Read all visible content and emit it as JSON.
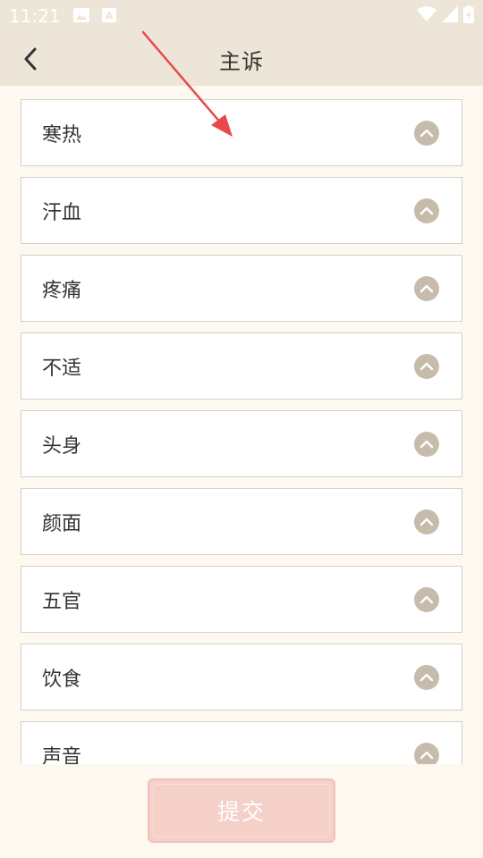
{
  "status_bar": {
    "time": "11:21",
    "left_icons": [
      "image-icon",
      "font-a-icon"
    ],
    "right_icons": [
      "wifi-icon",
      "cell-signal-icon",
      "battery-charging-icon"
    ]
  },
  "header": {
    "title": "主诉",
    "back_icon": "chevron-left-icon"
  },
  "categories": [
    {
      "label": "寒热"
    },
    {
      "label": "汗血"
    },
    {
      "label": "疼痛"
    },
    {
      "label": "不适"
    },
    {
      "label": "头身"
    },
    {
      "label": "颜面"
    },
    {
      "label": "五官"
    },
    {
      "label": "饮食"
    },
    {
      "label": "声音"
    }
  ],
  "toggle_icon": "chevron-up-circle-icon",
  "footer": {
    "submit_label": "提交"
  },
  "colors": {
    "header_bg": "#ece5d8",
    "page_bg": "#fdf9f1",
    "toggle": "#c7bcab",
    "submit_bg": "#f4d0c8",
    "annotation_arrow": "#e8484a"
  }
}
